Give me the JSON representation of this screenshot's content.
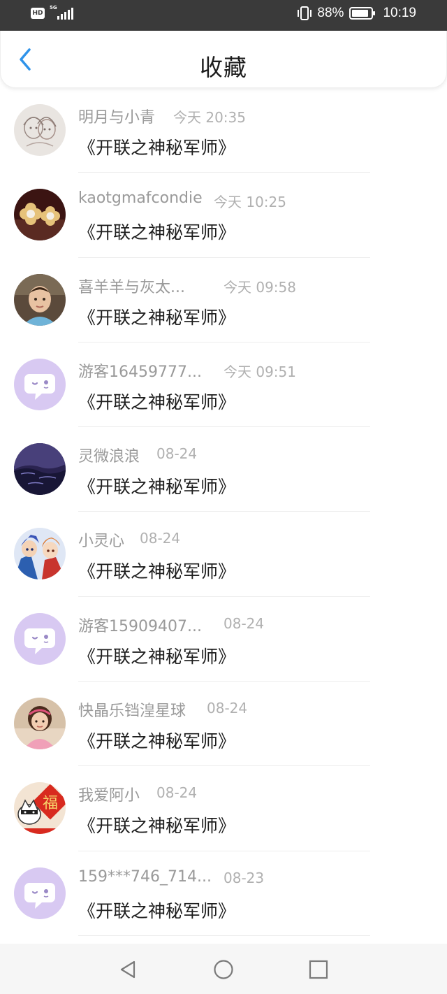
{
  "status_bar": {
    "hd_label": "HD",
    "network_label": "5G",
    "battery_text": "88%",
    "battery_level": 0.88,
    "time": "10:19"
  },
  "header": {
    "title": "收藏",
    "accent_color": "#2f93ea"
  },
  "items": [
    {
      "name": "明月与小青",
      "time": "今天 20:35",
      "title": "《开联之神秘军师》",
      "avatar": "sketch-couple-avatar"
    },
    {
      "name": "kaotgmafcondie",
      "time": "今天 10:25",
      "title": "《开联之神秘军师》",
      "avatar": "pearl-earrings-avatar"
    },
    {
      "name": "喜羊羊与灰太...",
      "time": "今天 09:58",
      "title": "《开联之神秘军师》",
      "avatar": "boy-photo-avatar"
    },
    {
      "name": "游客16459777...",
      "time": "今天 09:51",
      "title": "《开联之神秘军师》",
      "avatar": "default-chat-avatar"
    },
    {
      "name": "灵微浪浪",
      "time": "08-24",
      "title": "《开联之神秘军师》",
      "avatar": "night-sea-avatar"
    },
    {
      "name": "小灵心",
      "time": "08-24",
      "title": "《开联之神秘军师》",
      "avatar": "anime-heroes-avatar"
    },
    {
      "name": "游客15909407...",
      "time": "08-24",
      "title": "《开联之神秘军师》",
      "avatar": "default-chat-avatar"
    },
    {
      "name": "快晶乐铛湟星球",
      "time": "08-24",
      "title": "《开联之神秘军师》",
      "avatar": "girl-photo-avatar"
    },
    {
      "name": "我爱阿小",
      "time": "08-24",
      "title": "《开联之神秘军师》",
      "avatar": "fu-new-year-avatar"
    },
    {
      "name": "159***746_714...",
      "time": "08-23",
      "title": "《开联之神秘军师》",
      "avatar": "default-chat-avatar"
    }
  ],
  "nav": {
    "back": "triangle-back-icon",
    "home": "circle-home-icon",
    "recents": "square-recents-icon"
  }
}
